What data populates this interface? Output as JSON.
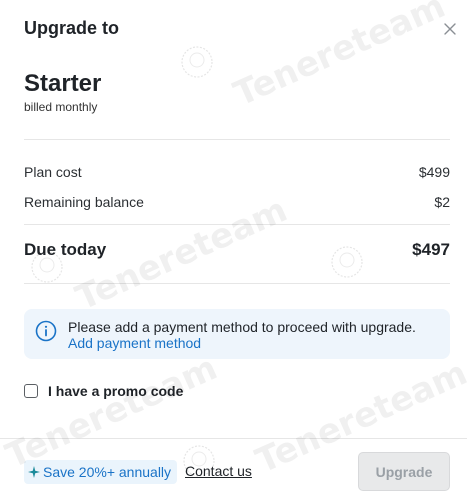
{
  "modal": {
    "title": "Upgrade to",
    "close_icon": "close-icon"
  },
  "plan": {
    "name": "Starter",
    "billing": "billed monthly"
  },
  "summary": {
    "plan_cost_label": "Plan cost",
    "plan_cost_value": "$499",
    "remaining_label": "Remaining balance",
    "remaining_value": "$2",
    "due_label": "Due today",
    "due_value": "$497"
  },
  "notice": {
    "icon": "info-icon",
    "message": "Please add a payment method to proceed with upgrade.",
    "link": "Add payment method"
  },
  "promo": {
    "label": "I have a promo code",
    "checked": false
  },
  "footer": {
    "save_badge": "Save 20%+ annually",
    "save_icon": "sparkle-icon",
    "contact": "Contact us",
    "upgrade_button": "Upgrade"
  },
  "watermark": {
    "text": "Tenereteam"
  },
  "colors": {
    "accent": "#1a73c7",
    "notice_bg": "#eef5fc",
    "disabled_button": "#e8e9ea"
  }
}
